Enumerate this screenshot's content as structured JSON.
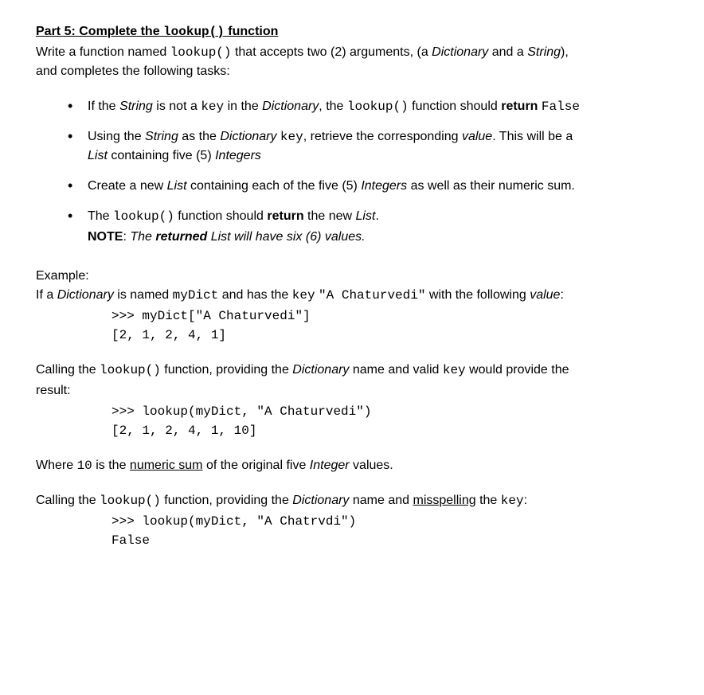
{
  "heading": {
    "prefix": "Part 5: Complete the ",
    "func": "lookup()",
    "suffix": " function"
  },
  "intro": {
    "p1_a": "Write a function named ",
    "p1_func": "lookup()",
    "p1_b": " that accepts two (2) arguments, (a ",
    "p1_dict": "Dictionary",
    "p1_c": " and a ",
    "p1_str": "String",
    "p1_d": "),",
    "p2": "and completes the following tasks:"
  },
  "bullets": {
    "b1": {
      "a": "If the ",
      "str": "String",
      "b": " is not a ",
      "key": "key",
      "c": " in the ",
      "dict": "Dictionary",
      "d": ", the ",
      "func": "lookup()",
      "e": " function should ",
      "ret": "return",
      "f": " ",
      "false": "False"
    },
    "b2": {
      "a": "Using the ",
      "str": "String",
      "b": " as the ",
      "dict": "Dictionary",
      "c": " ",
      "key": "key",
      "d": ", retrieve the corresponding ",
      "val": "value",
      "e": ". This will be a",
      "line2a": "",
      "list": "List",
      "f": " containing five (5) ",
      "ints": "Integers"
    },
    "b3": {
      "a": "Create a new ",
      "list": "List",
      "b": " containing each of the five (5) ",
      "ints": "Integers",
      "c": " as well as their numeric sum."
    },
    "b4": {
      "a": "The ",
      "func": "lookup()",
      "b": " function should ",
      "ret": "return",
      "c": " the new ",
      "list": "List",
      "d": ".",
      "note_label": "NOTE",
      "note_a": ": ",
      "note_b": "The ",
      "note_ret": "returned",
      "note_c": " List will have six (6) values."
    }
  },
  "example": {
    "label": "Example:",
    "desc_a": "If a ",
    "desc_dict": "Dictionary",
    "desc_b": " is named ",
    "desc_mydict": "myDict",
    "desc_c": " and has the ",
    "desc_key": "key",
    "desc_d": " ",
    "desc_keyval": "\"A Chaturvedi\"",
    "desc_e": " with the following ",
    "desc_value": "value",
    "desc_f": ":",
    "code1_l1": ">>> myDict[\"A Chaturvedi\"]",
    "code1_l2": "[2, 1, 2, 4, 1]"
  },
  "calling1": {
    "a": "Calling the ",
    "func": "lookup()",
    "b": " function, providing the ",
    "dict": "Dictionary",
    "c": " name and valid ",
    "key": "key",
    "d": " would provide the",
    "line2": "result:",
    "code_l1": ">>> lookup(myDict, \"A Chaturvedi\")",
    "code_l2": "[2, 1, 2, 4, 1, 10]"
  },
  "where": {
    "a": "Where ",
    "ten": "10",
    "b": " is the ",
    "sum": "numeric sum",
    "c": " of the original five ",
    "int": "Integer",
    "d": " values."
  },
  "calling2": {
    "a": "Calling the ",
    "func": "lookup()",
    "b": " function, providing the ",
    "dict": "Dictionary",
    "c": " name and ",
    "miss": "misspelling",
    "d": " the ",
    "key": "key",
    "e": ":",
    "code_l1": ">>> lookup(myDict, \"A Chatrvdi\")",
    "code_l2": "False"
  }
}
